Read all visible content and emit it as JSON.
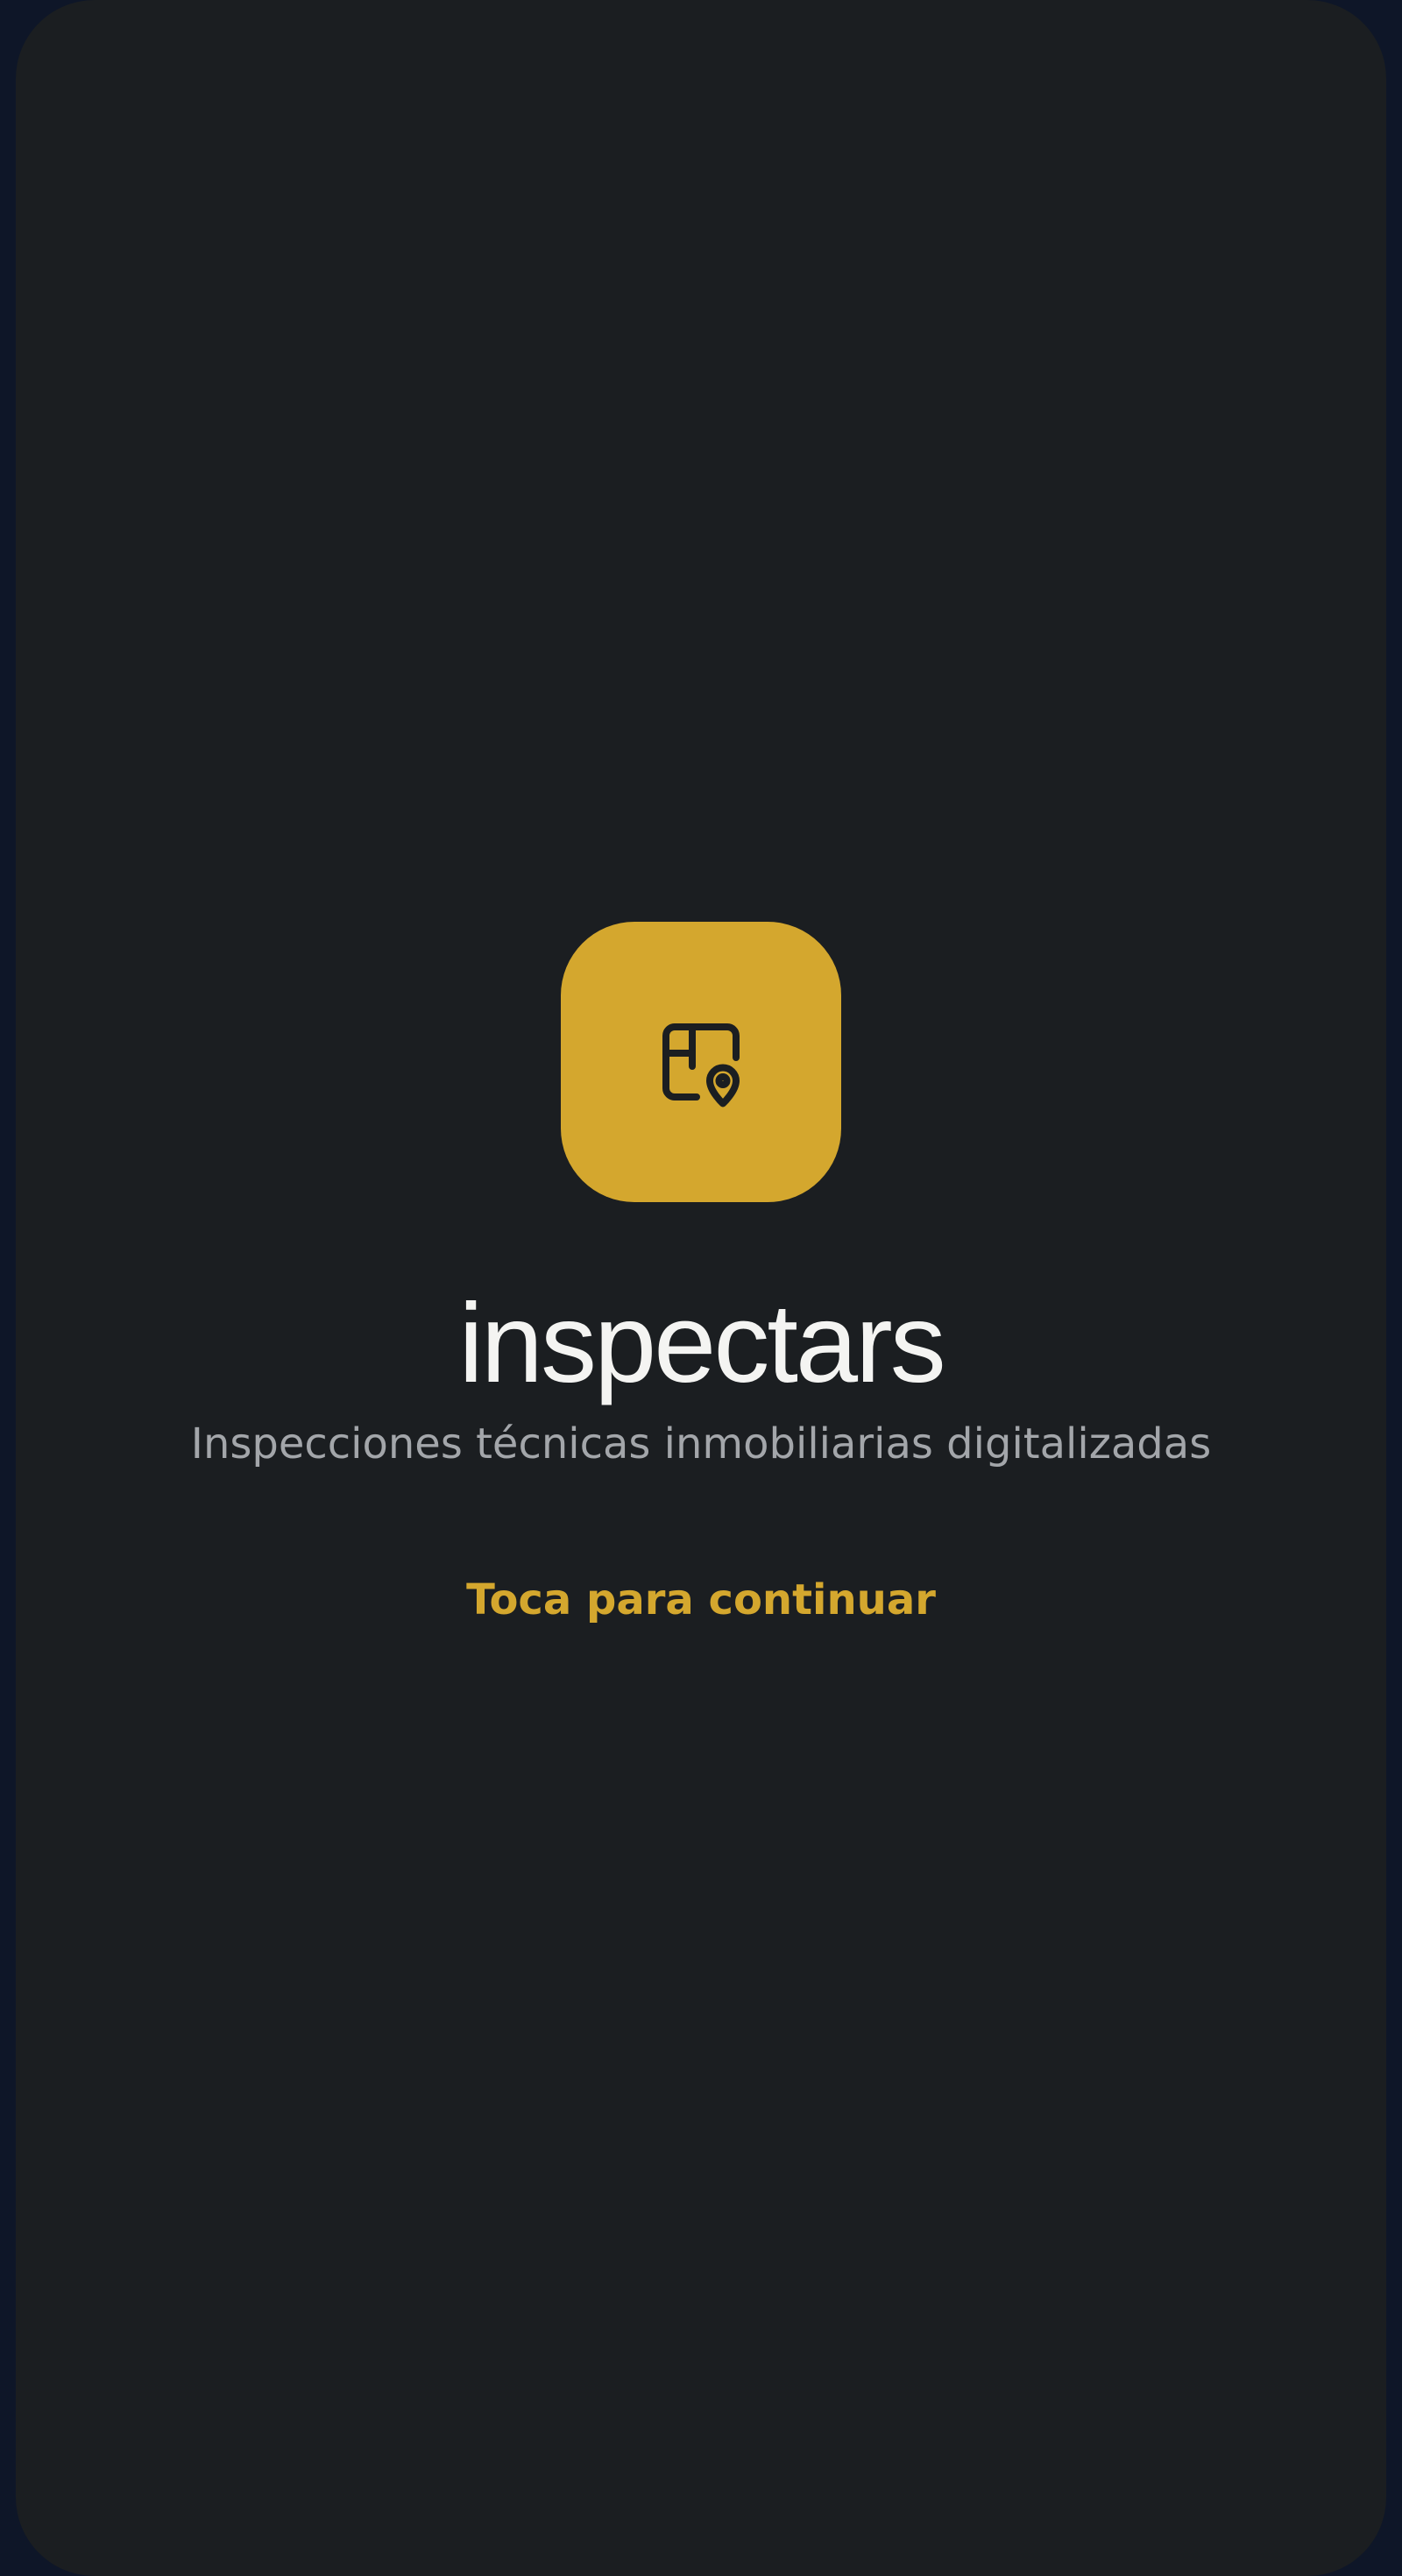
{
  "app": {
    "name": "inspectars",
    "tagline": "Inspecciones técnicas inmobiliarias digitalizadas",
    "continue_label": "Toca para continuar",
    "icon": "floorplan-location-pin-icon"
  },
  "colors": {
    "accent": "#d4a72e",
    "background": "#1b1e21",
    "frame": "#0e1628",
    "title_text": "#f4f4f2",
    "tagline_text": "#a3a6aa",
    "icon_stroke": "#1b1e21"
  }
}
